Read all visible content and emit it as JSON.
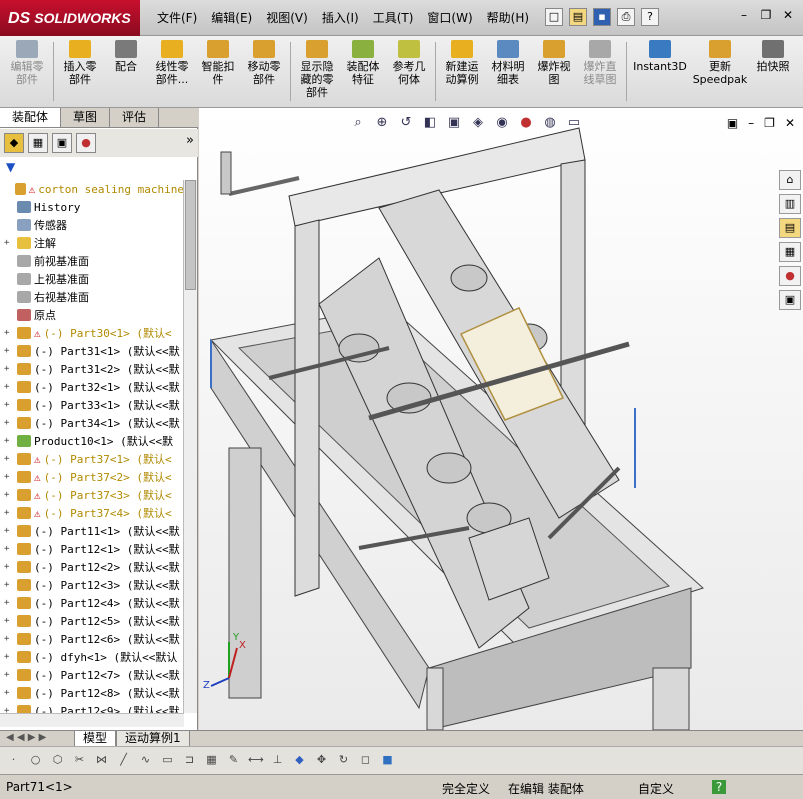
{
  "app": {
    "brand": "SOLIDWORKS",
    "brand_prefix": "DS"
  },
  "menu": [
    "文件(F)",
    "编辑(E)",
    "视图(V)",
    "插入(I)",
    "工具(T)",
    "窗口(W)",
    "帮助(H)"
  ],
  "toolbar": [
    {
      "label": "编辑零\n部件",
      "disabled": true,
      "color": "#9aa8b8"
    },
    {
      "label": "插入零\n部件",
      "disabled": false,
      "color": "#e8b020"
    },
    {
      "label": "配合",
      "disabled": false,
      "color": "#7a7a7a"
    },
    {
      "label": "线性零\n部件...",
      "disabled": false,
      "color": "#e8b020"
    },
    {
      "label": "智能扣\n件",
      "disabled": false,
      "color": "#d9a030"
    },
    {
      "label": "移动零\n部件",
      "disabled": false,
      "color": "#d9a030"
    },
    {
      "label": "显示隐\n藏的零\n部件",
      "disabled": false,
      "color": "#d9a030"
    },
    {
      "label": "装配体\n特征",
      "disabled": false,
      "color": "#8ab040"
    },
    {
      "label": "参考几\n何体",
      "disabled": false,
      "color": "#c0c040"
    },
    {
      "label": "新建运\n动算例",
      "disabled": false,
      "color": "#e8b020"
    },
    {
      "label": "材料明\n细表",
      "disabled": false,
      "color": "#5a8ac0"
    },
    {
      "label": "爆炸视\n图",
      "disabled": false,
      "color": "#d9a030"
    },
    {
      "label": "爆炸直\n线草图",
      "disabled": true,
      "color": "#a8a8a8"
    },
    {
      "label": "Instant3D",
      "disabled": false,
      "color": "#3a7ac0"
    },
    {
      "label": "更新\nSpeedpak",
      "disabled": false,
      "color": "#d9a030"
    },
    {
      "label": "拍快照",
      "disabled": false,
      "color": "#707070"
    }
  ],
  "panel": {
    "tabs": [
      "装配体",
      "草图",
      "评估"
    ],
    "chevron": "»",
    "filter": "▼",
    "tree": [
      {
        "pm": "",
        "label": "corton sealing machine",
        "warn": true,
        "yellow": true,
        "icon": "#d9a030"
      },
      {
        "pm": "",
        "label": "History",
        "warn": false,
        "yellow": false,
        "icon": "#6a8ab0"
      },
      {
        "pm": "",
        "label": "传感器",
        "warn": false,
        "yellow": false,
        "icon": "#8aa0c0"
      },
      {
        "pm": "+",
        "label": "注解",
        "warn": false,
        "yellow": false,
        "icon": "#e8c040"
      },
      {
        "pm": "",
        "label": "前视基准面",
        "warn": false,
        "yellow": false,
        "icon": "#a8a8a8"
      },
      {
        "pm": "",
        "label": "上视基准面",
        "warn": false,
        "yellow": false,
        "icon": "#a8a8a8"
      },
      {
        "pm": "",
        "label": "右视基准面",
        "warn": false,
        "yellow": false,
        "icon": "#a8a8a8"
      },
      {
        "pm": "",
        "label": "原点",
        "warn": false,
        "yellow": false,
        "icon": "#c06060"
      },
      {
        "pm": "+",
        "label": "(-) Part30<1> (默认<",
        "warn": true,
        "yellow": true,
        "icon": "#d9a030"
      },
      {
        "pm": "+",
        "label": "(-) Part31<1> (默认<<默",
        "warn": false,
        "yellow": false,
        "icon": "#d9a030"
      },
      {
        "pm": "+",
        "label": "(-) Part31<2> (默认<<默",
        "warn": false,
        "yellow": false,
        "icon": "#d9a030"
      },
      {
        "pm": "+",
        "label": "(-) Part32<1> (默认<<默",
        "warn": false,
        "yellow": false,
        "icon": "#d9a030"
      },
      {
        "pm": "+",
        "label": "(-) Part33<1> (默认<<默",
        "warn": false,
        "yellow": false,
        "icon": "#d9a030"
      },
      {
        "pm": "+",
        "label": "(-) Part34<1> (默认<<默",
        "warn": false,
        "yellow": false,
        "icon": "#d9a030"
      },
      {
        "pm": "+",
        "label": "Product10<1> (默认<<默",
        "warn": false,
        "yellow": false,
        "icon": "#70b040"
      },
      {
        "pm": "+",
        "label": "(-) Part37<1> (默认<",
        "warn": true,
        "yellow": true,
        "icon": "#d9a030"
      },
      {
        "pm": "+",
        "label": "(-) Part37<2> (默认<",
        "warn": true,
        "yellow": true,
        "icon": "#d9a030"
      },
      {
        "pm": "+",
        "label": "(-) Part37<3> (默认<",
        "warn": true,
        "yellow": true,
        "icon": "#d9a030"
      },
      {
        "pm": "+",
        "label": "(-) Part37<4> (默认<",
        "warn": true,
        "yellow": true,
        "icon": "#d9a030"
      },
      {
        "pm": "+",
        "label": "(-) Part11<1> (默认<<默",
        "warn": false,
        "yellow": false,
        "icon": "#d9a030"
      },
      {
        "pm": "+",
        "label": "(-) Part12<1> (默认<<默",
        "warn": false,
        "yellow": false,
        "icon": "#d9a030"
      },
      {
        "pm": "+",
        "label": "(-) Part12<2> (默认<<默",
        "warn": false,
        "yellow": false,
        "icon": "#d9a030"
      },
      {
        "pm": "+",
        "label": "(-) Part12<3> (默认<<默",
        "warn": false,
        "yellow": false,
        "icon": "#d9a030"
      },
      {
        "pm": "+",
        "label": "(-) Part12<4> (默认<<默",
        "warn": false,
        "yellow": false,
        "icon": "#d9a030"
      },
      {
        "pm": "+",
        "label": "(-) Part12<5> (默认<<默",
        "warn": false,
        "yellow": false,
        "icon": "#d9a030"
      },
      {
        "pm": "+",
        "label": "(-) Part12<6> (默认<<默",
        "warn": false,
        "yellow": false,
        "icon": "#d9a030"
      },
      {
        "pm": "+",
        "label": "(-) dfyh<1> (默认<<默认",
        "warn": false,
        "yellow": false,
        "icon": "#d9a030"
      },
      {
        "pm": "+",
        "label": "(-) Part12<7> (默认<<默",
        "warn": false,
        "yellow": false,
        "icon": "#d9a030"
      },
      {
        "pm": "+",
        "label": "(-) Part12<8> (默认<<默",
        "warn": false,
        "yellow": false,
        "icon": "#d9a030"
      },
      {
        "pm": "+",
        "label": "(-) Part12<9> (默认<<默",
        "warn": false,
        "yellow": false,
        "icon": "#d9a030"
      }
    ]
  },
  "bottom_tabs": [
    "模型",
    "运动算例1"
  ],
  "status": {
    "left": "Part71<1>",
    "defined": "完全定义",
    "editing": "在编辑 装配体",
    "custom": "自定义",
    "help": "?"
  },
  "axes": {
    "x": "X",
    "y": "Y",
    "z": "Z"
  }
}
